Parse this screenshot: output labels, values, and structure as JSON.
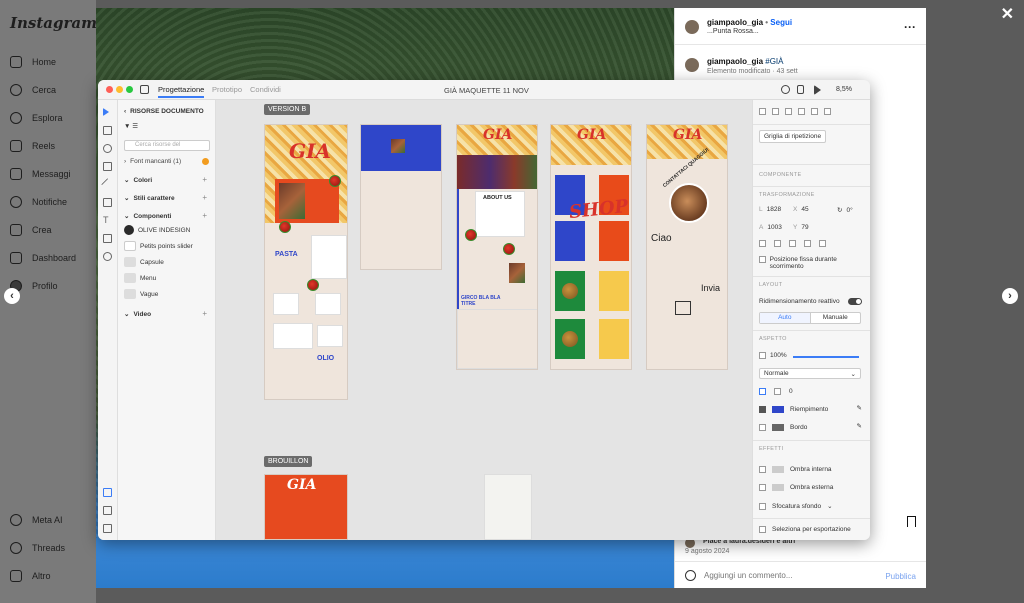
{
  "instagram": {
    "logo": "Instagram",
    "nav": [
      {
        "label": "Home",
        "icon": "home-icon"
      },
      {
        "label": "Cerca",
        "icon": "search-icon"
      },
      {
        "label": "Esplora",
        "icon": "compass-icon"
      },
      {
        "label": "Reels",
        "icon": "reels-icon"
      },
      {
        "label": "Messaggi",
        "icon": "messages-icon"
      },
      {
        "label": "Notifiche",
        "icon": "heart-icon"
      },
      {
        "label": "Crea",
        "icon": "plus-icon"
      },
      {
        "label": "Dashboard",
        "icon": "dashboard-icon"
      },
      {
        "label": "Profilo",
        "icon": "profile-avatar"
      }
    ],
    "nav_bottom": [
      {
        "label": "Meta AI",
        "icon": "meta-ai-icon"
      },
      {
        "label": "Threads",
        "icon": "threads-icon"
      },
      {
        "label": "Altro",
        "icon": "menu-icon"
      }
    ]
  },
  "post": {
    "username": "giampaolo_gia",
    "separator": "•",
    "follow": "Segui",
    "location": "...Punta Rossa...",
    "caption_user": "giampaolo_gia",
    "caption_tag": "#GIÀ",
    "caption_text": "Elemento modificato · 43 sett",
    "likes": "Piace a laura.desideri e altri",
    "date": "9 agosto 2024",
    "comment_placeholder": "Aggiungi un commento...",
    "publish": "Pubblica"
  },
  "app": {
    "tabs": [
      "Progettazione",
      "Prototipo",
      "Condividi"
    ],
    "doc_title": "GIÀ MAQUETTE 11 NOV",
    "zoom": "8,5%",
    "assets": {
      "header": "RISORSE DOCUMENTO",
      "search_placeholder": "Cerca risorse del",
      "missing_fonts": "Font mancanti (1)",
      "colors": "Colori",
      "char_styles": "Stili carattere",
      "components": "Componenti",
      "component_items": [
        "OLIVE INDESIGN",
        "Petits points slider",
        "Capsule",
        "Menu",
        "Vague"
      ],
      "video": "Video"
    },
    "canvas": {
      "label_version": "VERSION B",
      "label_draft": "BROUILLON",
      "board1_gia": "GIA",
      "board1_pasta": "PASTA",
      "board1_olio": "OLIO",
      "board3_about": "ABOUT US",
      "board3_title": "GIRCO BLA BLA TITRE",
      "board4_shop": "SHOP",
      "board5_title": "CONTATTACI QUAGGIÙ!",
      "board5_ciao": "Ciao",
      "board5_invia": "Invia",
      "draft_gia": "GIA"
    },
    "inspector": {
      "repeat_grid": "Griglia di ripetizione",
      "component_sec": "COMPONENTE",
      "transform_sec": "TRASFORMAZIONE",
      "w_label": "L",
      "w_val": "1828",
      "x_label": "X",
      "x_val": "45",
      "rot_val": "0°",
      "h_label": "A",
      "h_val": "1003",
      "y_label": "Y",
      "y_val": "79",
      "fixed_pos": "Posizione fissa durante scorrimento",
      "layout_sec": "LAYOUT",
      "responsive": "Ridimensionamento reattivo",
      "auto": "Auto",
      "manual": "Manuale",
      "appearance_sec": "ASPETTO",
      "opacity": "100%",
      "blend": "Normale",
      "radius": "0",
      "fill": "Riempimento",
      "border": "Bordo",
      "effects_sec": "EFFETTI",
      "inner_shadow": "Ombra interna",
      "drop_shadow": "Ombra esterna",
      "bg_blur": "Sfocatura sfondo",
      "export_select": "Seleziona per esportazione"
    }
  },
  "colors": {
    "fill": "#2f46c9",
    "border": "#666666",
    "accent": "#3b7cf6"
  }
}
